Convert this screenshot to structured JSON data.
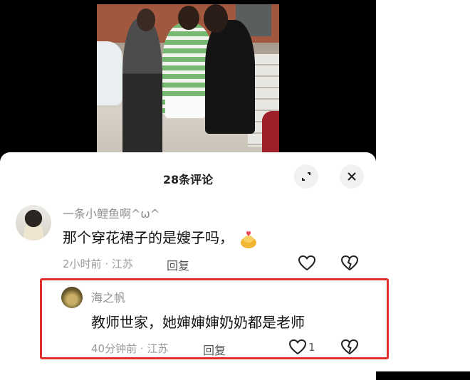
{
  "comments_panel": {
    "title": "28条评论"
  },
  "comments": [
    {
      "username": "一条小鲤鱼啊^ω^",
      "text": "那个穿花裙子的是嫂子吗，",
      "time": "2小时前",
      "location": "江苏",
      "reply_label": "回复",
      "emoji": "gold-ingot-sticker"
    },
    {
      "username": "海之帆",
      "text": "教师世家，她婶婶婶奶奶都是老师",
      "time": "40分钟前",
      "location": "江苏",
      "reply_label": "回复",
      "like_count": "1"
    }
  ],
  "colors": {
    "highlight_border": "#e0302b",
    "username": "#8e8e8e",
    "meta": "#9a9a9a"
  },
  "icons": [
    "expand-icon",
    "close-icon",
    "heart-icon",
    "broken-heart-icon"
  ]
}
